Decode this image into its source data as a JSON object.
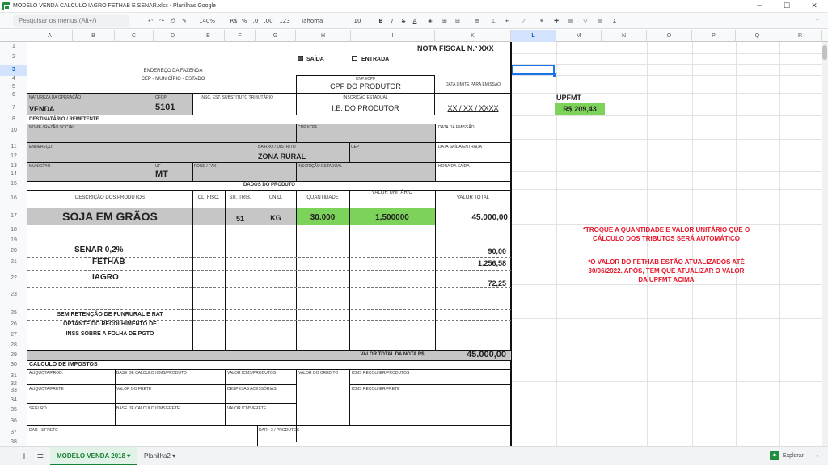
{
  "window": {
    "title": "MODELO VENDA CALCULO IAGRO FETHAB E SENAR.xlsx - Planilhas Google",
    "controls": [
      "─",
      "☐",
      "✕"
    ]
  },
  "toolbar": {
    "search_placeholder": "Pesquisar os menus (Alt+/)",
    "zoom": "140%",
    "currency": "R$",
    "percent": "%",
    "decimal_less": ".0",
    "decimal_more": ".00",
    "number_format": "123",
    "font": "Tahoma",
    "font_size": "10"
  },
  "columns": [
    "A",
    "B",
    "C",
    "D",
    "E",
    "F",
    "G",
    "H",
    "I",
    "K",
    "L",
    "M",
    "N",
    "O",
    "P",
    "Q",
    "R"
  ],
  "selected_column": "L",
  "rows": [
    "1",
    "2",
    "3",
    "4",
    "5",
    "6",
    "7",
    "8",
    "10",
    "11",
    "12",
    "13",
    "14",
    "15",
    "16",
    "17",
    "18",
    "19",
    "20",
    "21",
    "22",
    "23",
    "25",
    "26",
    "27",
    "28",
    "29",
    "30",
    "31",
    "32",
    "33",
    "34",
    "35",
    "36",
    "37",
    "38"
  ],
  "selected_row": "3",
  "invoice": {
    "title": "NOTA FISCAL N.º XXX",
    "saida_label": "SAÍDA",
    "saida_checked": true,
    "entrada_label": "ENTRADA",
    "entrada_checked": false,
    "address_line1": "ENDEREÇO DA FAZENDA",
    "address_line2": "CEP   -   MUNICÍPIO   -   ESTADO",
    "cnpj_label": "CNPJ/CPF",
    "cnpj_value": "CPF DO PRODUTOR",
    "data_limite_label": "DATA LIMITE PARA EMISSÃO",
    "natureza_label": "NATUREZA DA OPERAÇÃO",
    "natureza_value": "VENDA",
    "cfop_label": "CFOP",
    "cfop_value": "5101",
    "insc_subst_label": "INSC. EST. SUBSTITUTO TRIBUTÁRIO",
    "insc_estadual_label": "INSCRIÇÃO ESTADUAL",
    "insc_estadual_value": "I.E. DO PRODUTOR",
    "data_value": "XX / XX / XXXX",
    "destinatario_header": "DESTINATÁRIO / REMETENTE",
    "nome_label": "NOME / RAZÃO SOCIAL",
    "dest_cnpj_label": "CNPJ/CPF",
    "data_emissao_label": "DATA DA EMISSÃO",
    "endereco_label": "ENDEREÇO",
    "bairro_label": "BAIRRO / DISTRITO",
    "bairro_value": "ZONA RURAL",
    "cep_label": "CEP",
    "data_saida_label": "DATA SAÍDA/ENTRADA",
    "municipio_label": "MUNICÍPIO",
    "uf_label": "UF",
    "uf_value": "MT",
    "fone_label": "FONE / FAX",
    "dest_insc_label": "INSCRIÇÃO ESTADUAL",
    "hora_saida_label": "HORA DA SAÍDA",
    "dados_produto_header": "DADOS DO PRODUTO",
    "col_descricao": "DESCRIÇÃO DOS PRODUTOS",
    "col_clfisc": "CL. FISC.",
    "col_sittrib": "SIT. TRIB.",
    "col_unid": "UNID.",
    "col_quantidade": "QUANTIDADE",
    "col_valor_unitario": "VALOR UNITÁRIO",
    "col_valor_total": "VALOR TOTAL",
    "product_name": "SOJA EM GRÃOS",
    "product_sit": "51",
    "product_unid": "KG",
    "product_qty": "30.000",
    "product_unit_price": "1,500000",
    "product_total": "45.000,00",
    "senar_label": "SENAR 0,2%",
    "senar_value": "90,00",
    "fethab_label": "FETHAB",
    "fethab_value": "1.256,58",
    "iagro_label": "IAGRO",
    "iagro_value": "72,25",
    "note1": "SEM RETENÇÃO DE FUNRURAL E RAT",
    "note2": "OPTANTE DO RECOLHIMENTO DE",
    "note3": "INSS SOBRE A FOLHA DE PGTO",
    "valor_total_label": "VALOR TOTAL DA NOTA R$",
    "valor_total_value": "45.000,00",
    "calculo_header": "CALCULO DE IMPOSTOS",
    "aliquota_prod_label": "ALÍQUOTA/PROD.",
    "base_icms_prod_label": "BASE DE CALCULO ICMS/PRODUTO",
    "valor_icms_prod_label": "VALOR ICMS/PRODUTOS",
    "valor_credito_label": "VALOR DO CREDITO",
    "icms_recolher_prod_label": "ICMS RECOLHER/PRODUTOS",
    "aliquota_frete_label": "ALÍQUOTA/FRETE",
    "valor_frete_label": "VALOR DO FRETE",
    "despesas_label": "DESPESAS ACESSÓRIAS",
    "icms_recolher_frete_label": "ICMS RECOLHER/FRETE",
    "seguro_label": "SEGURO",
    "base_icms_frete_label": "BASE DE CALCULO ICMS/FRETE",
    "valor_icms_frete_label": "VALOR ICMS/FRETE",
    "dar_frete_label": "DAR - 3/FRETE",
    "dar_produtos_label": "DAR - 3 / PRODUTOS"
  },
  "side": {
    "upfmt_label": "UPFMT",
    "upfmt_value": "R$ 209,43",
    "note_a_line1": "*TROQUE A QUANTIDADE E VALOR UNITÁRIO QUE O",
    "note_a_line2": "CÁLCULO DOS TRIBUTOS SERÁ AUTOMÁTICO",
    "note_b_line1": "*O VALOR DO FETHAB ESTÃO ATUALIZADOS ATÉ",
    "note_b_line2": "30/06/2022. APÓS, TEM QUE ATUALIZAR O VALOR",
    "note_b_line3": "DA UPFMT ACIMA"
  },
  "tabs": {
    "add": "+",
    "all_sheets": "≡",
    "sheet1": "MODELO VENDA 2018",
    "sheet2": "Planilha2",
    "explore": "Explorar"
  },
  "colors": {
    "green_fill": "#7dd35a",
    "gray_fill": "#c6c6c6",
    "red_note": "#e8152a",
    "accent_green": "#188038"
  }
}
